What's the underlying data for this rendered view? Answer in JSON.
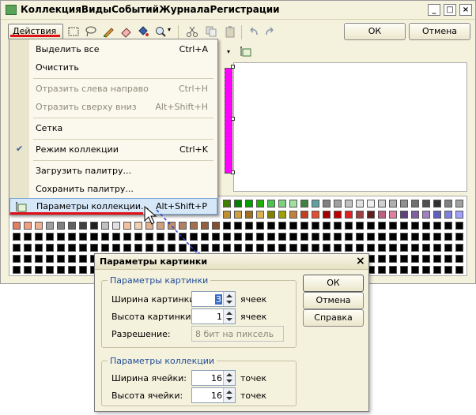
{
  "window": {
    "title": "КоллекцияВидыСобытийЖурналаРегистрации",
    "min_glyph": "_",
    "max_glyph": "□",
    "close_glyph": "×"
  },
  "toolbar": {
    "actions_label": "Действия",
    "actions_arrow": "▾",
    "ok_label": "ОК",
    "cancel_label": "Отмена"
  },
  "menu": {
    "items": [
      {
        "label": "Выделить все",
        "shortcut": "Ctrl+A"
      },
      {
        "label": "Очистить",
        "shortcut": ""
      },
      {
        "label": "Отразить слева направо",
        "shortcut": "Ctrl+H"
      },
      {
        "label": "Отразить сверху вниз",
        "shortcut": "Alt+Shift+H"
      },
      {
        "label": "Сетка",
        "shortcut": ""
      },
      {
        "label": "Режим коллекции",
        "shortcut": "Ctrl+K",
        "checked": true
      },
      {
        "label": "Загрузить палитру...",
        "shortcut": ""
      },
      {
        "label": "Сохранить палитру...",
        "shortcut": ""
      },
      {
        "label": "Параметры коллекции...",
        "shortcut": "Alt+Shift+P",
        "highlighted": true
      }
    ],
    "check_glyph": "✔"
  },
  "dialog": {
    "title": "Параметры картинки",
    "close_glyph": "×",
    "group_picture": "Параметры картинки",
    "width_label": "Ширина картинки:",
    "width_value": "3",
    "width_unit": "ячеек",
    "height_label": "Высота картинки:",
    "height_value": "1",
    "height_unit": "ячеек",
    "resolution_label": "Разрешение:",
    "resolution_value": "8 бит на пиксель",
    "group_collection": "Параметры коллекции",
    "cell_width_label": "Ширина ячейки:",
    "cell_width_value": "16",
    "cell_width_unit": "точек",
    "cell_height_label": "Высота ячейки:",
    "cell_height_value": "16",
    "cell_height_unit": "точек",
    "ok_label": "ОК",
    "cancel_label": "Отмена",
    "help_label": "Справка"
  },
  "colors": {
    "accent_red": "#e0101b",
    "magenta": "#ff00ff",
    "selection": "#d6e7f8",
    "dashed_arrow": "#2a3fd6"
  }
}
